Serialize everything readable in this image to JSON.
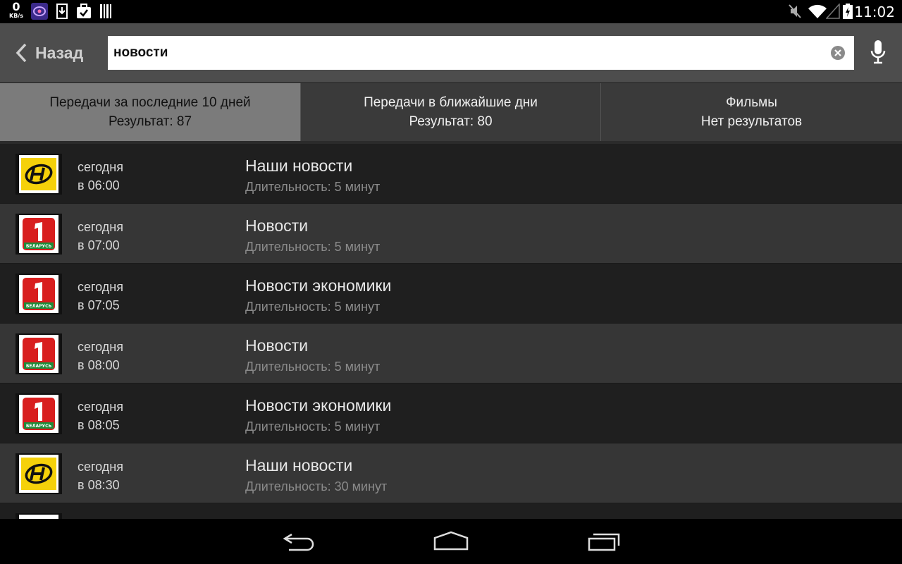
{
  "status_bar": {
    "speed_value": "0",
    "speed_unit": "KB/s",
    "time": "11:02",
    "left_icons": [
      "eye-app-icon",
      "download-icon",
      "briefcase-check-icon",
      "barcode-icon"
    ],
    "right_icons": [
      "mute-icon",
      "wifi-icon",
      "signal-icon",
      "battery-charging-icon"
    ]
  },
  "action_bar": {
    "back_label": "Назад",
    "search_value": "новости",
    "icons": {
      "back": "chevron-left-icon",
      "clear": "clear-circle-icon",
      "mic": "microphone-icon"
    }
  },
  "tabs": [
    {
      "title": "Передачи за последние 10 дней",
      "result": "Результат: 87",
      "active": true
    },
    {
      "title": "Передачи в ближайшие дни",
      "result": "Результат: 80",
      "active": false
    },
    {
      "title": "Фильмы",
      "result": "Нет результатов",
      "active": false
    }
  ],
  "results": [
    {
      "channel_logo": "ont-logo",
      "day": "сегодня",
      "time": "в 06:00",
      "title": "Наши новости",
      "duration": "Длительность: 5 минут"
    },
    {
      "channel_logo": "belarus-1-logo",
      "day": "сегодня",
      "time": "в 07:00",
      "title": "Новости",
      "duration": "Длительность: 5 минут"
    },
    {
      "channel_logo": "belarus-1-logo",
      "day": "сегодня",
      "time": "в 07:05",
      "title": "Новости экономики",
      "duration": "Длительность: 5 минут"
    },
    {
      "channel_logo": "belarus-1-logo",
      "day": "сегодня",
      "time": "в 08:00",
      "title": "Новости",
      "duration": "Длительность: 5 минут"
    },
    {
      "channel_logo": "belarus-1-logo",
      "day": "сегодня",
      "time": "в 08:05",
      "title": "Новости экономики",
      "duration": "Длительность: 5 минут"
    },
    {
      "channel_logo": "ont-logo",
      "day": "сегодня",
      "time": "в 08:30",
      "title": "Наши новости",
      "duration": "Длительность: 30 минут"
    }
  ],
  "belarus_logo_text": "БЕЛАРУСЬ",
  "nav_bar": {
    "icons": [
      "back-nav-icon",
      "home-nav-icon",
      "recents-nav-icon"
    ]
  }
}
